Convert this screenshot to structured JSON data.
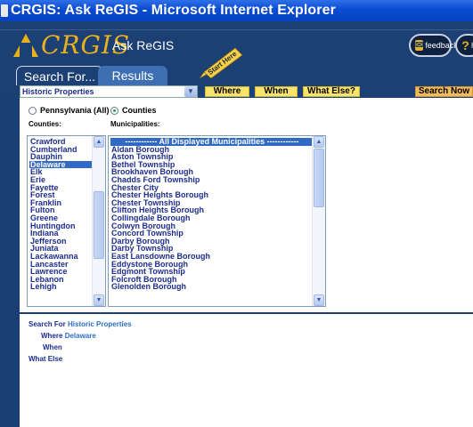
{
  "window": {
    "title": "CRGIS: Ask ReGIS - Microsoft Internet Explorer"
  },
  "header": {
    "logo": "CRGIS",
    "subtitle": "Ask ReGIS",
    "feedback_label": "feedback",
    "help_label": "he",
    "start_here": "Start Here"
  },
  "tabs": [
    {
      "label": "Search For..."
    },
    {
      "label": "Results"
    }
  ],
  "toolbar": {
    "topic_value": "Historic Properties",
    "where_label": "Where",
    "when_label": "When",
    "what_else_label": "What Else?",
    "search_now_label": "Search Now"
  },
  "scope": {
    "option_pa": "Pennsylvania (All)",
    "option_counties": "Counties",
    "selected": "Counties"
  },
  "counties": {
    "heading": "Counties:",
    "items": [
      "Crawford",
      "Cumberland",
      "Dauphin",
      "Delaware",
      "Elk",
      "Erie",
      "Fayette",
      "Forest",
      "Franklin",
      "Fulton",
      "Greene",
      "Huntingdon",
      "Indiana",
      "Jefferson",
      "Juniata",
      "Lackawanna",
      "Lancaster",
      "Lawrence",
      "Lebanon",
      "Lehigh"
    ],
    "selected": "Delaware"
  },
  "municipalities": {
    "heading": "Municipalities:",
    "items": [
      "------------ All Displayed Municipalities ------------",
      "Aldan Borough",
      "Aston Township",
      "Bethel Township",
      "Brookhaven Borough",
      "Chadds Ford Township",
      "Chester City",
      "Chester Heights Borough",
      "Chester Township",
      "Clifton Heights Borough",
      "Collingdale Borough",
      "Colwyn Borough",
      "Concord Township",
      "Darby Borough",
      "Darby Township",
      "East Lansdowne Borough",
      "Eddystone Borough",
      "Edgmont Township",
      "Folcroft Borough",
      "Glenolden Borough"
    ],
    "selected": "------------ All Displayed Municipalities ------------"
  },
  "summary": {
    "search_for_label": "Search For",
    "search_for_value": "Historic Properties",
    "where_label": "Where",
    "where_value": "Delaware",
    "when_label": "When",
    "what_else_label": "What Else"
  },
  "colors": {
    "accent": "#e9b21c",
    "header_bg": "#1c3f74",
    "selection": "#316ac5"
  }
}
